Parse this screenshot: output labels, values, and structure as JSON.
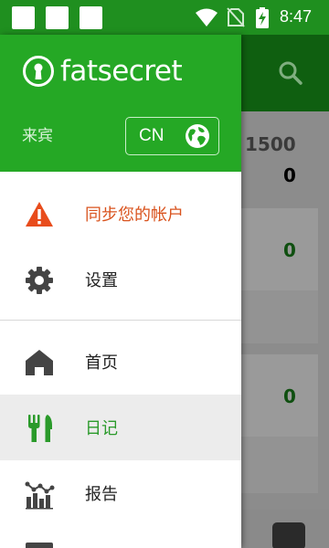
{
  "status_bar": {
    "time": "8:47",
    "icons": [
      "notification-square-icon",
      "notification-square-icon",
      "notification-square-icon",
      "wifi-icon",
      "no-sim-icon",
      "battery-charging-icon"
    ]
  },
  "background_app": {
    "target_value": "1500",
    "consumed_value": "0",
    "card_values": [
      "0",
      "0"
    ],
    "icons": [
      "search-icon"
    ]
  },
  "drawer": {
    "brand": "fatsecret",
    "user_label": "来宾",
    "region_button": "CN",
    "accent_color": "#25a825",
    "menu": {
      "sync_account": "同步您的帐户",
      "settings": "设置",
      "home": "首页",
      "diary": "日记",
      "reports": "报告"
    },
    "selected_item": "日记"
  }
}
